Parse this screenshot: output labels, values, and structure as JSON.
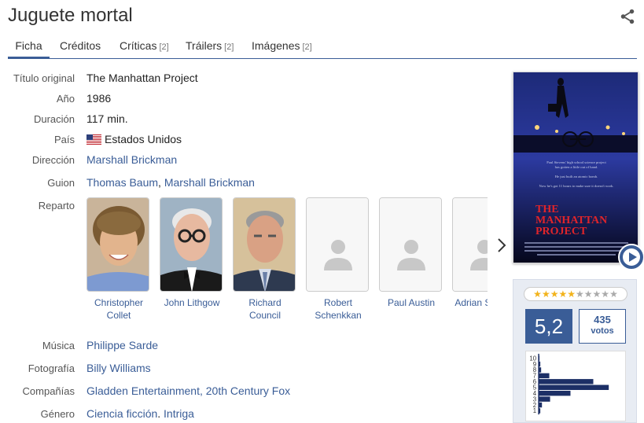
{
  "title": "Juguete mortal",
  "tabs": [
    {
      "label": "Ficha",
      "count": ""
    },
    {
      "label": "Créditos",
      "count": ""
    },
    {
      "label": "Críticas",
      "count": "[2]"
    },
    {
      "label": "Tráilers",
      "count": "[2]"
    },
    {
      "label": "Imágenes",
      "count": "[2]"
    }
  ],
  "details": {
    "original_title_label": "Título original",
    "original_title": "The Manhattan Project",
    "year_label": "Año",
    "year": "1986",
    "duration_label": "Duración",
    "duration": "117 min.",
    "country_label": "País",
    "country": "Estados Unidos",
    "country_flag": "us-flag-icon",
    "direction_label": "Dirección",
    "director": "Marshall Brickman",
    "screenplay_label": "Guion",
    "screenwriters": [
      "Thomas Baum",
      "Marshall Brickman"
    ],
    "cast_label": "Reparto",
    "music_label": "Música",
    "music": "Philippe Sarde",
    "photography_label": "Fotografía",
    "photography": "Billy Williams",
    "companies_label": "Compañías",
    "companies": "Gladden Entertainment, 20th Century Fox",
    "genre_label": "Género",
    "genres": [
      "Ciencia ficción",
      "Intriga"
    ]
  },
  "cast": [
    {
      "name": "Christopher Collet",
      "has_photo": true
    },
    {
      "name": "John Lithgow",
      "has_photo": true
    },
    {
      "name": "Richard Council",
      "has_photo": true
    },
    {
      "name": "Robert Schenkkan",
      "has_photo": false
    },
    {
      "name": "Paul Austin",
      "has_photo": false
    },
    {
      "name": "Adrian Sparks",
      "has_photo": false
    }
  ],
  "poster": {
    "title_line1": "THE",
    "title_line2": "MANHATTAN",
    "title_line3": "PROJECT",
    "tagline": [
      "Paul Stevens' high school science project",
      "has gotten a little out of hand.",
      "He just built an atomic bomb.",
      "Now he's got 11 hours to make sure it doesn't work."
    ]
  },
  "rating": {
    "stars_total": 10,
    "stars_filled": 5,
    "average": "5,2",
    "votes": "435",
    "votes_label": "votos",
    "histogram": {
      "scores": [
        10,
        9,
        8,
        7,
        6,
        5,
        4,
        3,
        2,
        1
      ],
      "share": [
        0.01,
        0.02,
        0.03,
        0.13,
        0.67,
        0.86,
        0.39,
        0.14,
        0.04,
        0.02
      ]
    }
  },
  "colors": {
    "accent": "#3a5d97",
    "star_on": "#f2b31b",
    "star_off": "#aaaaaa",
    "panel_bg": "#e8ecf3"
  }
}
